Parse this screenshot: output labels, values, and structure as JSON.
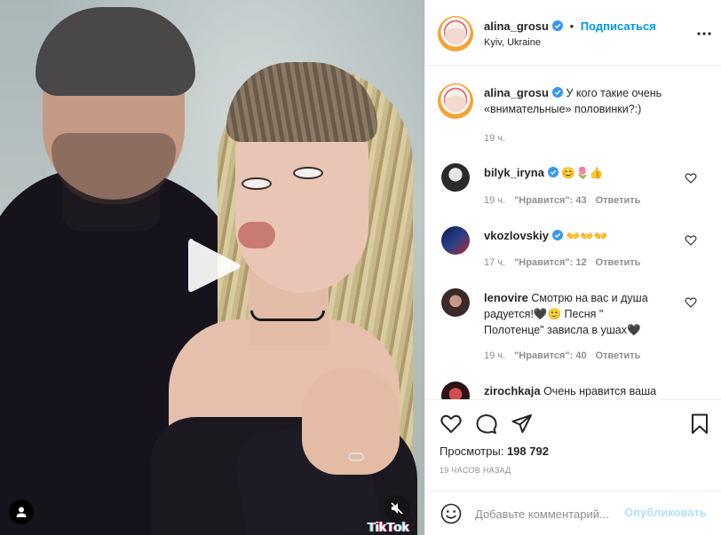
{
  "header": {
    "username": "alina_grosu",
    "separator": "•",
    "follow_label": "Подписаться",
    "location": "Kyiv, Ukraine"
  },
  "caption": {
    "username": "alina_grosu",
    "text": "У кого такие очень «внимательные» половинки?:)",
    "time": "19 ч."
  },
  "comments": [
    {
      "username": "bilyk_iryna",
      "text": "😊🌷👍",
      "time": "19 ч.",
      "likes": "\"Нравится\": 43",
      "reply": "Ответить"
    },
    {
      "username": "vkozlovskiy",
      "text": "👐👐👐",
      "time": "17 ч.",
      "likes": "\"Нравится\": 12",
      "reply": "Ответить"
    },
    {
      "username": "lenovire",
      "text_lines": [
        "Смотрю на вас и душа",
        "радуется!🖤🙂 Песня \"",
        "Полотенце\" зависла в ушах🖤"
      ],
      "time": "19 ч.",
      "likes": "\"Нравится\": 40",
      "reply": "Ответить"
    },
    {
      "username": "zirochkaja",
      "text": "Очень нравится ваша"
    }
  ],
  "stats": {
    "views_label": "Просмотры:",
    "views_value": "198 792",
    "posted_ago": "19 ЧАСОВ НАЗАД"
  },
  "add_comment": {
    "placeholder": "Добавьте комментарий...",
    "publish_label": "Опубликовать"
  },
  "media": {
    "watermark": "TikTok"
  },
  "colors": {
    "accent": "#0095f6",
    "publish_disabled": "#b2dffc",
    "muted_text": "#8e8e8e"
  }
}
